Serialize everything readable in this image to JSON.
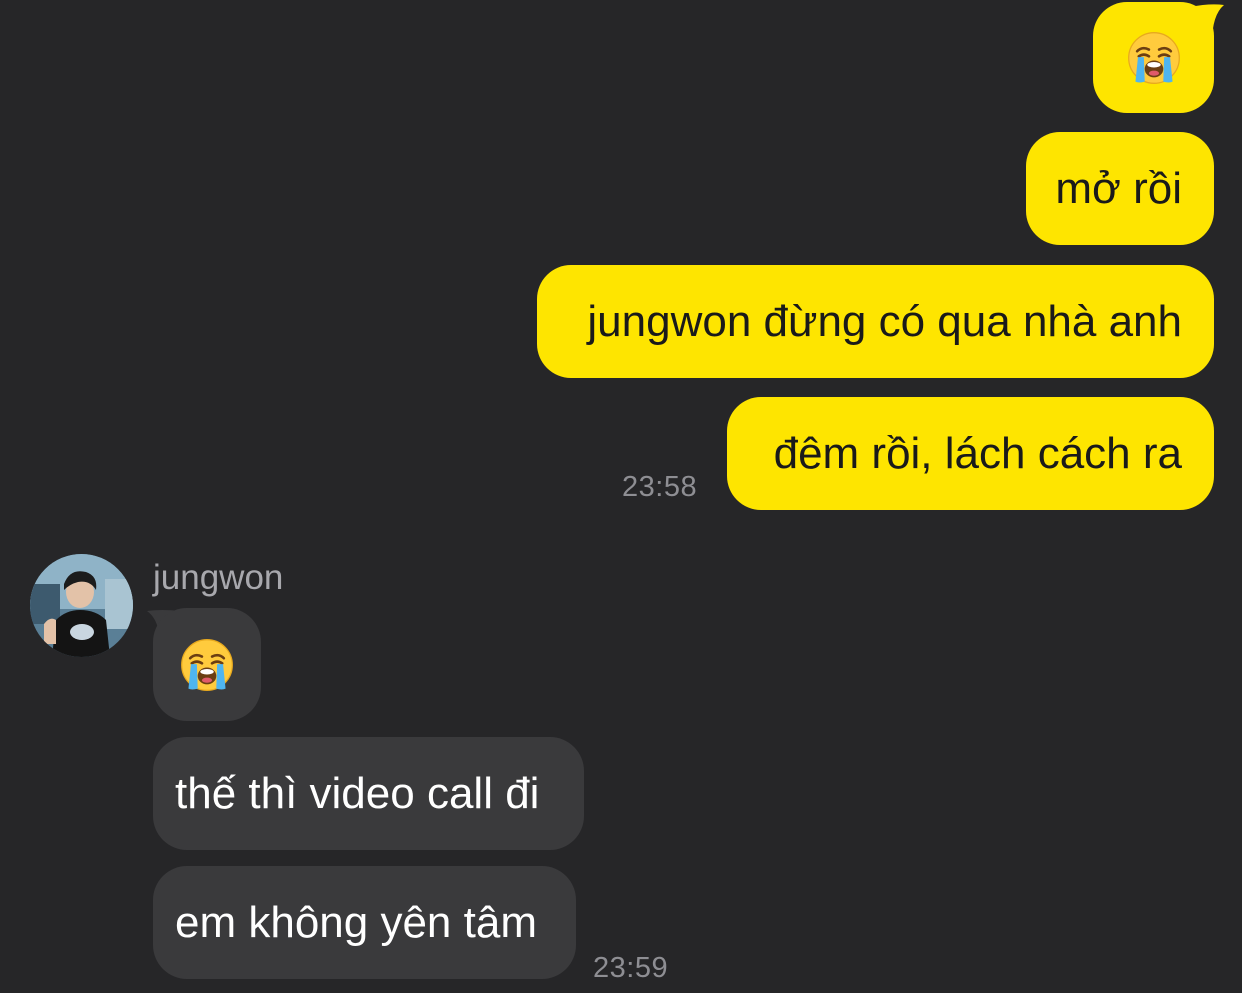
{
  "colors": {
    "background": "#262628",
    "my_bubble": "#FEE500",
    "their_bubble": "#3a3a3c",
    "timestamp": "#8e8e93"
  },
  "outgoing": {
    "emoji_icon": "loudly-crying-face-icon",
    "msg1": "mở rồi",
    "msg2": "jungwon đừng có qua nhà anh",
    "msg3": "đêm rồi, lách cách ra",
    "time": "23:58"
  },
  "incoming": {
    "sender": "jungwon",
    "avatar_icon": "profile-photo",
    "emoji_icon": "loudly-crying-face-icon",
    "msg1": "thế thì video call đi",
    "msg2": "em không yên tâm",
    "time": "23:59"
  }
}
